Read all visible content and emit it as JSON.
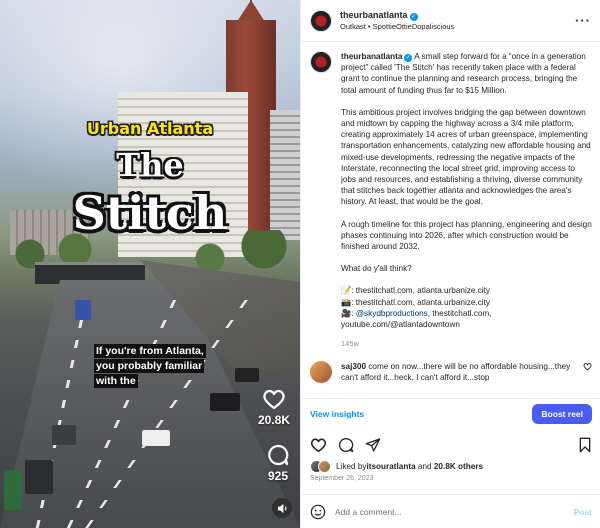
{
  "video": {
    "overlay_line1": "Urban Atlanta",
    "overlay_line2": "The",
    "overlay_line3": "Stitch",
    "caption_text": "If you're from Atlanta, you probably familiar with the",
    "like_count": "20.8K",
    "comment_count": "925"
  },
  "header": {
    "username": "theurbanatlanta",
    "audio": "Outkast • SpottieOttieDopaliscious"
  },
  "post": {
    "username": "theurbanatlanta",
    "para1": "A small step forward for a “once in a generation project” called 'The Stitch' has recently taken place with a federal grant to continue the planning and research process, bringing the total amount of funding thus far to $15 Million.",
    "para2": "This ambitious project involves bridging the gap between downtown and midtown by capping the highway across a 3/4 mile platform, creating approximately 14 acres of urban greenspace, implementing transportation enhancements, catalyzing new affordable housing and mixed-use developments, redressing the negative impacts of the Interstate, reconnecting the local street grid, improving access to jobs and resources, and establishing a thriving, diverse community that stitches back together atlanta and acknowledges the area's history. At least, that would be the goal.",
    "para3": "A rough timeline for this project has planning, engineering and design phases continuing into 2026, after which construction would be finished around 2032.",
    "para4": "What do y'all think?",
    "src1": "📝: thestitchatl.com, atlanta.urbanize.city",
    "src2": "📸: thestitchatl.com, atlanta.urbanize.city",
    "src3_mention": "@skydbproductions",
    "src3_rest": ", thestitchatl.com,",
    "src4": "youtube.com/@atlantadowntown",
    "age": "145w"
  },
  "comment": {
    "username": "saj300",
    "text": "come on now...there will be no affordable housing...they can't afford it...heck, I can't afford it...stop"
  },
  "insights": {
    "view_label": "View insights",
    "boost_label": "Boost reel"
  },
  "likes": {
    "prefix": "Liked by ",
    "user": "itsouratlanta",
    "middle": " and ",
    "count": "20.8K others"
  },
  "date": "September 26, 2023",
  "add_comment": {
    "placeholder": "Add a comment...",
    "post_label": "Post"
  }
}
